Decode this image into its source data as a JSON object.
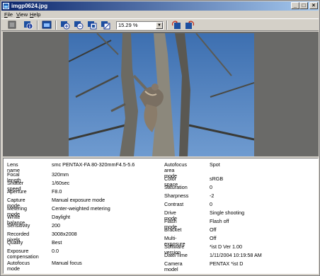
{
  "window": {
    "title": "imgp0624.jpg",
    "controls": {
      "minimize": "_",
      "maximize": "□",
      "close": "×"
    }
  },
  "menu": [
    {
      "pre": "",
      "ul": "F",
      "post": "ile"
    },
    {
      "pre": "",
      "ul": "V",
      "post": "iew"
    },
    {
      "pre": "",
      "ul": "H",
      "post": "elp"
    }
  ],
  "toolbar": {
    "icons": [
      "close-image-icon",
      "image-info-icon",
      "fit-window-icon",
      "zoom-in-icon",
      "zoom-out-icon",
      "actual-size-icon",
      "fit-screen-icon",
      "rotate-left-icon",
      "rotate-right-icon"
    ],
    "zoom": {
      "value": "15.29 %",
      "arrow": "▼"
    }
  },
  "info": {
    "left": [
      {
        "label": "Lens name",
        "value": "smc PENTAX-FA 80-320mmF4.5-5.6"
      },
      {
        "label": "Focal length",
        "value": "320mm"
      },
      {
        "label": "Shutter speed",
        "value": "1/60sec"
      },
      {
        "label": "Aperture",
        "value": "F8.0"
      },
      {
        "label": "Capture mode",
        "value": "Manual exposure mode"
      },
      {
        "label": "Metering mode",
        "value": "Center-weighted metering"
      },
      {
        "label": "White balance",
        "value": "Daylight"
      },
      {
        "label": "Sensitivity",
        "value": "200"
      },
      {
        "label": "Recorded pixels",
        "value": "3008x2008"
      },
      {
        "label": "Quality",
        "value": "Best"
      },
      {
        "label": "Exposure\ncompensation",
        "value": "0.0"
      },
      {
        "label": "Autofocus mode",
        "value": "Manual focus"
      }
    ],
    "right": [
      {
        "label": "Autofocus\narea mode",
        "value": "Spot"
      },
      {
        "label": "Color space",
        "value": "sRGB"
      },
      {
        "label": "Saturation",
        "value": "0"
      },
      {
        "label": "Sharpness",
        "value": "-2"
      },
      {
        "label": "Contrast",
        "value": "0"
      },
      {
        "label": "Drive mode",
        "value": "Single shooting"
      },
      {
        "label": "Flash mode",
        "value": "Flash off"
      },
      {
        "label": "Bracket",
        "value": "Off"
      },
      {
        "label": "Multi-exposure",
        "value": "Off"
      },
      {
        "label": "Software version",
        "value": "*ist D      Ver 1.00"
      },
      {
        "label": "Date/Time",
        "value": "1/11/2004 10:19:58 AM"
      },
      {
        "label": "Camera model",
        "value": "PENTAX *ist D"
      }
    ]
  }
}
